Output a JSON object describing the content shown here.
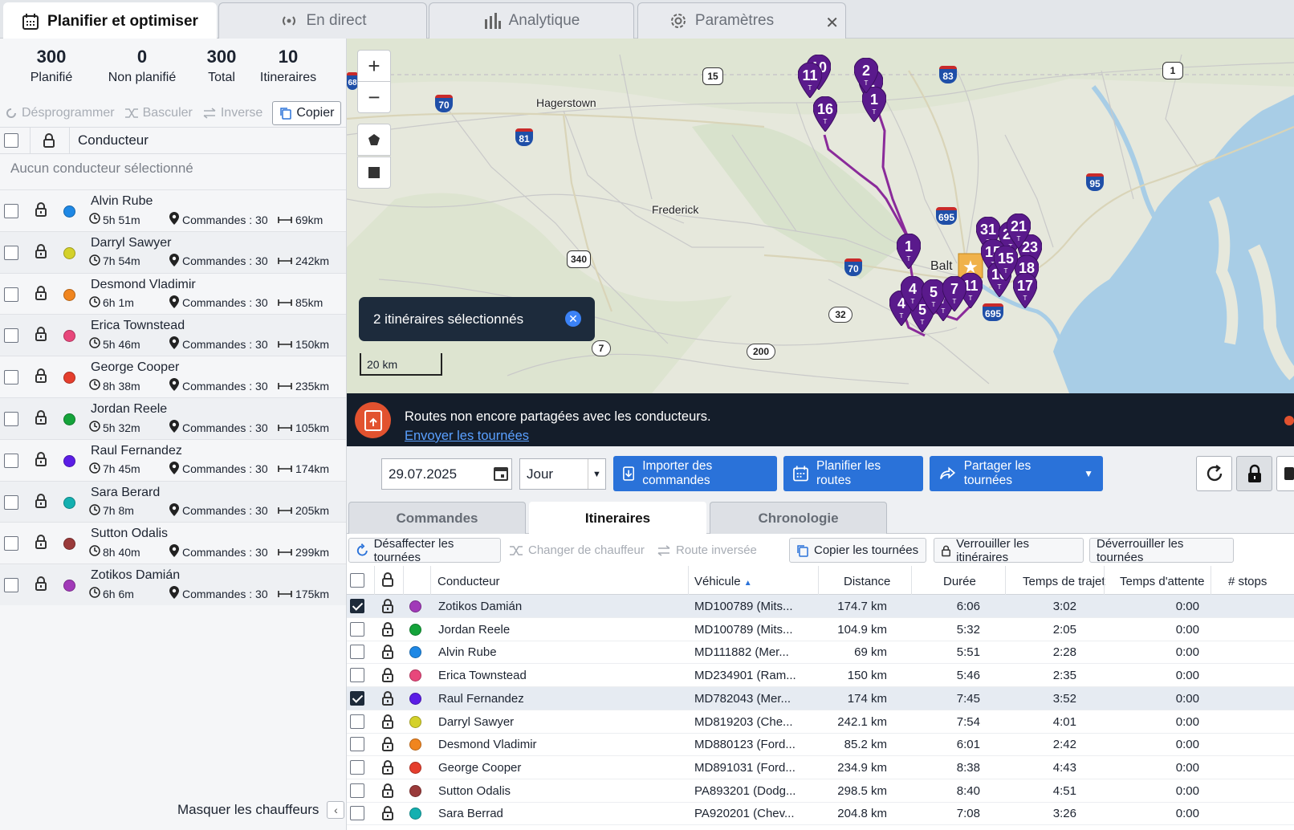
{
  "top_tabs": [
    {
      "label": "Planifier et optimiser",
      "icon": "calendar-icon"
    },
    {
      "label": "En direct",
      "icon": "broadcast-icon"
    },
    {
      "label": "Analytique",
      "icon": "bar-chart-icon"
    },
    {
      "label": "Paramètres",
      "icon": "gear-icon"
    }
  ],
  "stats": [
    {
      "value": "300",
      "label": "Planifié"
    },
    {
      "value": "0",
      "label": "Non planifié"
    },
    {
      "value": "300",
      "label": "Total"
    },
    {
      "value": "10",
      "label": "Itineraires"
    }
  ],
  "left_toolbar": {
    "unschedule": "Désprogrammer",
    "switch": "Basculer",
    "reverse": "Inverse",
    "copy": "Copier"
  },
  "left_header": {
    "driver": "Conducteur",
    "no_driver": "Aucun conducteur sélectionné"
  },
  "drivers": [
    {
      "name": "Alvin Rube",
      "time": "5h 51m",
      "orders": "Commandes : 30",
      "dist": "69km",
      "color": "#1e88e5"
    },
    {
      "name": "Darryl Sawyer",
      "time": "7h 54m",
      "orders": "Commandes : 30",
      "dist": "242km",
      "color": "#d4d12a"
    },
    {
      "name": "Desmond Vladimir",
      "time": "6h 1m",
      "orders": "Commandes : 30",
      "dist": "85km",
      "color": "#f0851f"
    },
    {
      "name": "Erica Townstead",
      "time": "5h 46m",
      "orders": "Commandes : 30",
      "dist": "150km",
      "color": "#e8477b"
    },
    {
      "name": "George Cooper",
      "time": "8h 38m",
      "orders": "Commandes : 30",
      "dist": "235km",
      "color": "#e53e2d"
    },
    {
      "name": "Jordan Reele",
      "time": "5h 32m",
      "orders": "Commandes : 30",
      "dist": "105km",
      "color": "#14a33a"
    },
    {
      "name": "Raul Fernandez",
      "time": "7h 45m",
      "orders": "Commandes : 30",
      "dist": "174km",
      "color": "#5b1de6"
    },
    {
      "name": "Sara Berard",
      "time": "7h 8m",
      "orders": "Commandes : 30",
      "dist": "205km",
      "color": "#14b0b0"
    },
    {
      "name": "Sutton Odalis",
      "time": "8h 40m",
      "orders": "Commandes : 30",
      "dist": "299km",
      "color": "#9a3a3a"
    },
    {
      "name": "Zotikos Damián",
      "time": "6h 6m",
      "orders": "Commandes : 30",
      "dist": "175km",
      "color": "#a13ab8"
    }
  ],
  "hide_drivers": "Masquer les chauffeurs",
  "map": {
    "toast": "2 itinéraires sélectionnés",
    "scale": "20 km",
    "places": {
      "hagerstown": "Hagerstown",
      "frederick": "Frederick",
      "balt": "Balt"
    },
    "highways": {
      "h70a": "70",
      "h81": "81",
      "h15": "15",
      "h83": "83",
      "h1": "1",
      "h95": "95",
      "h695": "695",
      "h340": "340",
      "h70b": "70",
      "h32": "32",
      "h7": "7",
      "h200": "200",
      "h695b": "695",
      "h68": "68"
    },
    "pins": {
      "p10": "10",
      "p11": "11",
      "p16a": "16",
      "p2": "2",
      "p1a": "1",
      "p1b": "1",
      "p31": "31",
      "p21": "21",
      "p23": "23",
      "p15": "15",
      "p18": "18",
      "p16b": "16",
      "p17": "17",
      "p4": "4",
      "p5": "5",
      "p7": "7",
      "p11b": "11"
    },
    "pin_letter": "T"
  },
  "banner": {
    "text": "Routes non encore partagées avec les conducteurs.",
    "link": "Envoyer les tournées"
  },
  "controls": {
    "date": "29.07.2025",
    "period": "Jour",
    "import": "Importer des commandes",
    "plan": "Planifier les routes",
    "share": "Partager les tournées"
  },
  "sub_tabs": [
    "Commandes",
    "Itineraires",
    "Chronologie"
  ],
  "actions": {
    "unassign": "Désaffecter les tournées",
    "change_driver": "Changer de chauffeur",
    "reverse": "Route inversée",
    "copy": "Copier les tournées",
    "lock": "Verrouiller les itinéraires",
    "unlock": "Déverrouiller les tournées"
  },
  "table": {
    "headers": {
      "driver": "Conducteur",
      "vehicle": "Véhicule",
      "distance": "Distance",
      "duration": "Durée",
      "travel": "Temps de trajet",
      "wait": "Temps d'attente",
      "stops": "# stops"
    },
    "rows": [
      {
        "checked": true,
        "driver": "Zotikos Damián",
        "vehicle": "MD100789 (Mits...",
        "distance": "174.7 km",
        "duration": "6:06",
        "travel": "3:02",
        "wait": "0:00",
        "color": "#a13ab8"
      },
      {
        "checked": false,
        "driver": "Jordan Reele",
        "vehicle": "MD100789 (Mits...",
        "distance": "104.9 km",
        "duration": "5:32",
        "travel": "2:05",
        "wait": "0:00",
        "color": "#14a33a"
      },
      {
        "checked": false,
        "driver": "Alvin Rube",
        "vehicle": "MD111882 (Mer...",
        "distance": "69 km",
        "duration": "5:51",
        "travel": "2:28",
        "wait": "0:00",
        "color": "#1e88e5"
      },
      {
        "checked": false,
        "driver": "Erica Townstead",
        "vehicle": "MD234901 (Ram...",
        "distance": "150 km",
        "duration": "5:46",
        "travel": "2:35",
        "wait": "0:00",
        "color": "#e8477b"
      },
      {
        "checked": true,
        "driver": "Raul Fernandez",
        "vehicle": "MD782043 (Mer...",
        "distance": "174 km",
        "duration": "7:45",
        "travel": "3:52",
        "wait": "0:00",
        "color": "#5b1de6"
      },
      {
        "checked": false,
        "driver": "Darryl Sawyer",
        "vehicle": "MD819203 (Che...",
        "distance": "242.1 km",
        "duration": "7:54",
        "travel": "4:01",
        "wait": "0:00",
        "color": "#d4d12a"
      },
      {
        "checked": false,
        "driver": "Desmond Vladimir",
        "vehicle": "MD880123 (Ford...",
        "distance": "85.2 km",
        "duration": "6:01",
        "travel": "2:42",
        "wait": "0:00",
        "color": "#f0851f"
      },
      {
        "checked": false,
        "driver": "George Cooper",
        "vehicle": "MD891031 (Ford...",
        "distance": "234.9 km",
        "duration": "8:38",
        "travel": "4:43",
        "wait": "0:00",
        "color": "#e53e2d"
      },
      {
        "checked": false,
        "driver": "Sutton Odalis",
        "vehicle": "PA893201 (Dodg...",
        "distance": "298.5 km",
        "duration": "8:40",
        "travel": "4:51",
        "wait": "0:00",
        "color": "#9a3a3a"
      },
      {
        "checked": false,
        "driver": "Sara Berrad",
        "vehicle": "PA920201 (Chev...",
        "distance": "204.8 km",
        "duration": "7:08",
        "travel": "3:26",
        "wait": "0:00",
        "color": "#14b0b0"
      }
    ]
  },
  "colors": {
    "accent": "#2a72d9",
    "pin": "#5a1a8c",
    "banner_bg": "#141d2a"
  }
}
